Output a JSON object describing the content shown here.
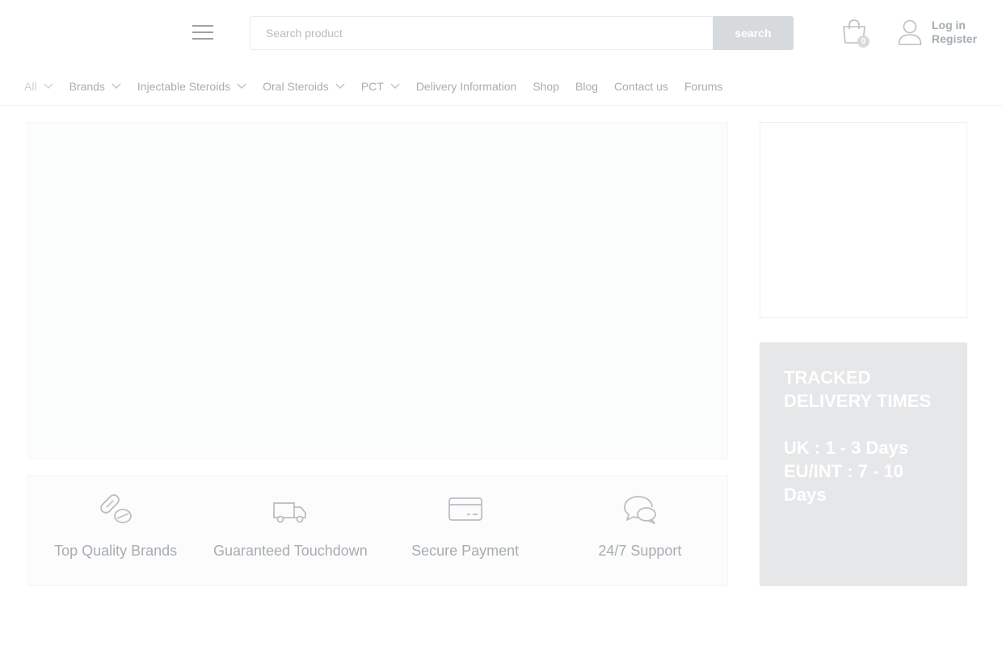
{
  "header": {
    "search": {
      "placeholder": "Search product",
      "button_label": "search"
    },
    "cart": {
      "count": "0"
    },
    "account": {
      "login_label": "Log in",
      "register_label": "Register"
    }
  },
  "nav": {
    "items": [
      {
        "label": "All",
        "dropdown": true
      },
      {
        "label": "Brands",
        "dropdown": true
      },
      {
        "label": "Injectable Steroids",
        "dropdown": true
      },
      {
        "label": "Oral Steroids",
        "dropdown": true
      },
      {
        "label": "PCT",
        "dropdown": true
      },
      {
        "label": "Delivery Information",
        "dropdown": false
      },
      {
        "label": "Shop",
        "dropdown": false
      },
      {
        "label": "Blog",
        "dropdown": false
      },
      {
        "label": "Contact us",
        "dropdown": false
      },
      {
        "label": "Forums",
        "dropdown": false
      }
    ]
  },
  "features": [
    {
      "label": "Top Quality Brands",
      "icon": "pills-icon"
    },
    {
      "label": "Guaranteed Touchdown",
      "icon": "truck-icon"
    },
    {
      "label": "Secure Payment",
      "icon": "credit-card-icon"
    },
    {
      "label": "24/7 Support",
      "icon": "chat-bubbles-icon"
    }
  ],
  "delivery": {
    "title": "TRACKED DELIVERY TIMES",
    "uk": "UK : 1 - 3 Days",
    "eu": "EU/INT : 7 - 10 Days"
  },
  "colors": {
    "muted_text": "#a8aeb2",
    "button_bg": "#d7dadc",
    "delivery_bg": "#e6e7e8"
  }
}
